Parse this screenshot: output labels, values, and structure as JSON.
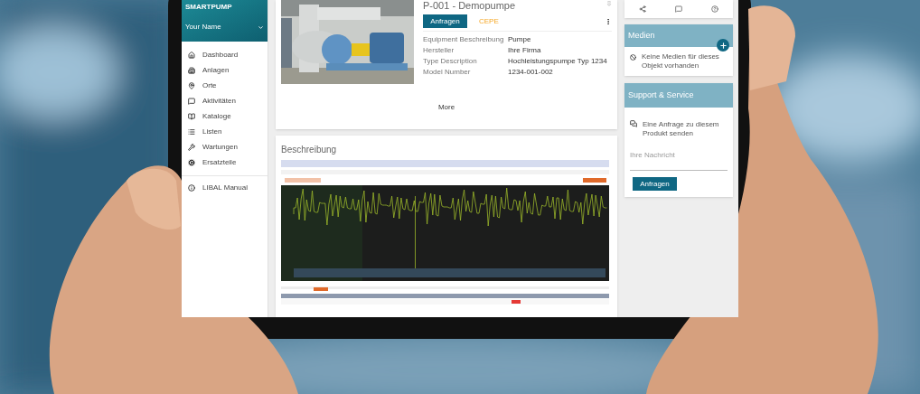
{
  "sidebar": {
    "brand": "SMARTPUMP",
    "user": "Your Name",
    "items": [
      {
        "label": "Dashboard"
      },
      {
        "label": "Anlagen"
      },
      {
        "label": "Orte"
      },
      {
        "label": "Aktivitäten"
      },
      {
        "label": "Kataloge"
      },
      {
        "label": "Listen"
      },
      {
        "label": "Wartungen"
      },
      {
        "label": "Ersatzteile"
      }
    ],
    "footer_items": [
      {
        "label": "LIBAL Manual"
      }
    ]
  },
  "equipment": {
    "title": "P-001 - Demopumpe",
    "primary_button": "Anfragen",
    "tag": "CEPE",
    "details": [
      {
        "label": "Equipment Beschreibung",
        "value": "Pumpe"
      },
      {
        "label": "Hersteller",
        "value": "Ihre Firma"
      },
      {
        "label": "Type Description",
        "value": "Hochleistungspumpe Typ 1234"
      },
      {
        "label": "Model Number",
        "value": "1234-001-002"
      }
    ],
    "more": "More"
  },
  "description": {
    "title": "Beschreibung"
  },
  "media": {
    "title": "Medien",
    "empty_text": "Keine Medien für dieses Objekt vorhanden"
  },
  "support": {
    "title": "Support & Service",
    "request_text": "Eine Anfrage zu diesem Produkt senden",
    "message_placeholder": "Ihre Nachricht",
    "button": "Anfragen"
  }
}
